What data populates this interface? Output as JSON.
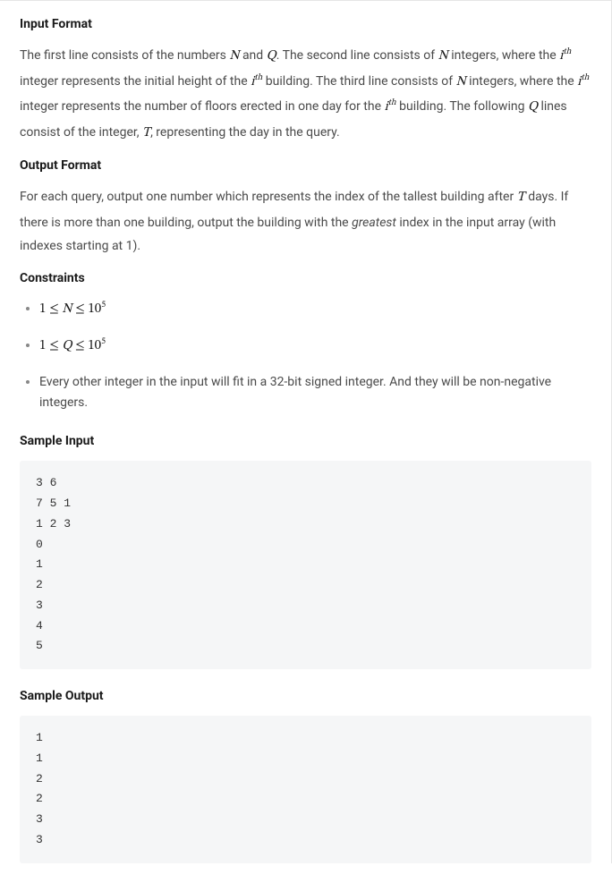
{
  "sections": {
    "input_format": {
      "heading": "Input Format",
      "body_parts": {
        "p1": "The first line consists of the numbers ",
        "m1": "N",
        "p2": " and ",
        "m2": "Q",
        "p3": ". The second line consists of ",
        "m3": "N",
        "p4": " integers, where the ",
        "m4_base": "i",
        "m4_sup": "th",
        "p5": " integer represents the initial height of the ",
        "m5_base": "i",
        "m5_sup": "th",
        "p6": " building. The third line consists of ",
        "m6": "N",
        "p7": " integers, where the ",
        "m7_base": "i",
        "m7_sup": "th",
        "p8": " integer represents the number of floors erected in one day for the ",
        "m8_base": "i",
        "m8_sup": "th",
        "p9": " building. The following ",
        "m9": "Q",
        "p10": " lines consist of the integer, ",
        "m10": "T",
        "p11": ", representing the day in the query."
      }
    },
    "output_format": {
      "heading": "Output Format",
      "body_parts": {
        "p1": "For each query, output one number which represents the index of the tallest building after ",
        "m1": "T",
        "p2": " days. If there is more than one building, output the building with the ",
        "em": "greatest",
        "p3": " index in the input array (with indexes starting at 1)."
      }
    },
    "constraints": {
      "heading": "Constraints",
      "items": {
        "c1": {
          "lhs": "1",
          "op1": "≤",
          "var": "N",
          "op2": "≤",
          "rhs_base": "10",
          "rhs_exp": "5"
        },
        "c2": {
          "lhs": "1",
          "op1": "≤",
          "var": "Q",
          "op2": "≤",
          "rhs_base": "10",
          "rhs_exp": "5"
        },
        "c3": "Every other integer in the input will fit in a 32-bit signed integer. And they will be non-negative integers."
      }
    },
    "sample_input": {
      "heading": "Sample Input",
      "code": "3 6\n7 5 1\n1 2 3\n0\n1\n2\n3\n4\n5"
    },
    "sample_output": {
      "heading": "Sample Output",
      "code": "1\n1\n2\n2\n3\n3"
    }
  }
}
